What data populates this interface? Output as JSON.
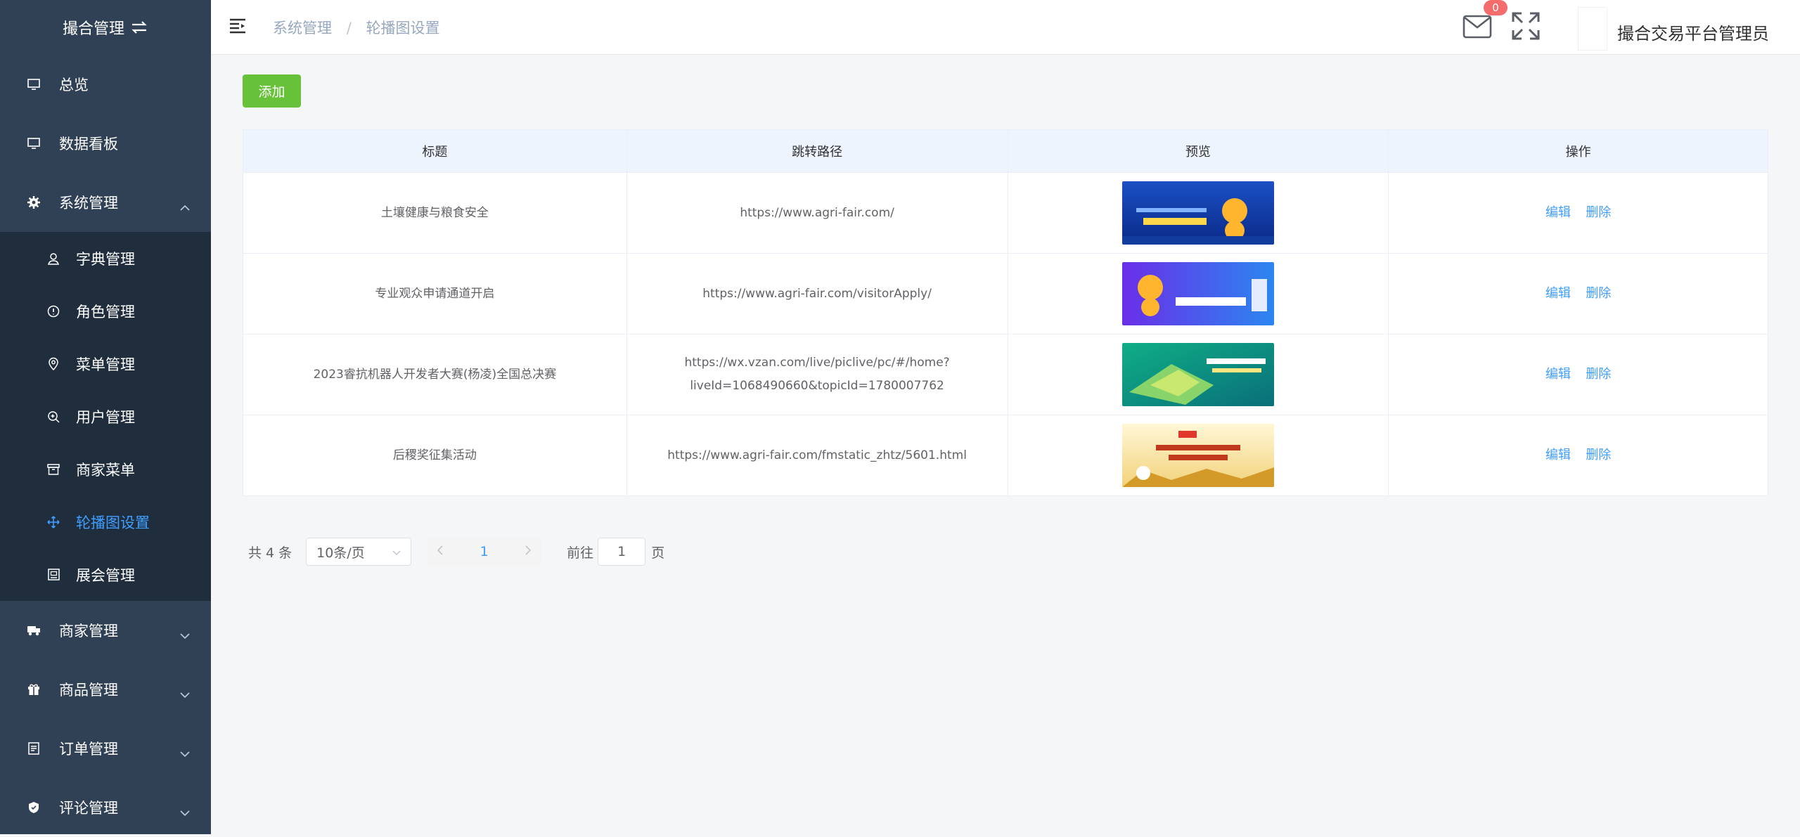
{
  "sidebar": {
    "brand": "撮合管理",
    "items": [
      {
        "label": "总览",
        "icon": "monitor-icon"
      },
      {
        "label": "数据看板",
        "icon": "monitor-icon"
      },
      {
        "label": "系统管理",
        "icon": "gear-icon",
        "expanded": true
      }
    ],
    "sub_items": [
      {
        "label": "字典管理",
        "icon": "user-icon"
      },
      {
        "label": "角色管理",
        "icon": "info-icon"
      },
      {
        "label": "菜单管理",
        "icon": "location-icon"
      },
      {
        "label": "用户管理",
        "icon": "zoom-icon"
      },
      {
        "label": "商家菜单",
        "icon": "box-icon"
      },
      {
        "label": "轮播图设置",
        "icon": "move-icon",
        "active": true
      },
      {
        "label": "展会管理",
        "icon": "picture-icon"
      }
    ],
    "bottom_items": [
      {
        "label": "商家管理",
        "icon": "truck-icon"
      },
      {
        "label": "商品管理",
        "icon": "gift-icon"
      },
      {
        "label": "订单管理",
        "icon": "document-icon"
      },
      {
        "label": "评论管理",
        "icon": "shield-icon"
      }
    ]
  },
  "header": {
    "breadcrumb": [
      "系统管理",
      "轮播图设置"
    ],
    "mail_badge": "0",
    "username": "撮合交易平台管理员"
  },
  "toolbar": {
    "add_label": "添加"
  },
  "table": {
    "columns": [
      "标题",
      "跳转路径",
      "预览",
      "操作"
    ],
    "rows": [
      {
        "title": "土壤健康与粮食安全",
        "path": "https://www.agri-fair.com/",
        "edit": "编辑",
        "delete": "删除"
      },
      {
        "title": "专业观众申请通道开启",
        "path": "https://www.agri-fair.com/visitorApply/",
        "edit": "编辑",
        "delete": "删除"
      },
      {
        "title": "2023睿抗机器人开发者大赛(杨凌)全国总决赛",
        "path": "https://wx.vzan.com/live/piclive/pc/#/home?liveId=1068490660&topicId=1780007762",
        "edit": "编辑",
        "delete": "删除"
      },
      {
        "title": "后稷奖征集活动",
        "path": "https://www.agri-fair.com/fmstatic_zhtz/5601.html",
        "edit": "编辑",
        "delete": "删除"
      }
    ]
  },
  "pagination": {
    "total": "共 4 条",
    "page_size": "10条/页",
    "current": "1",
    "goto_label": "前往",
    "goto_value": "1",
    "goto_unit": "页"
  },
  "colors": {
    "sidebar_bg": "#304156",
    "submenu_bg": "#1f2d3d",
    "accent": "#409eff",
    "add_button": "#67c23a",
    "badge": "#f56c6c"
  }
}
